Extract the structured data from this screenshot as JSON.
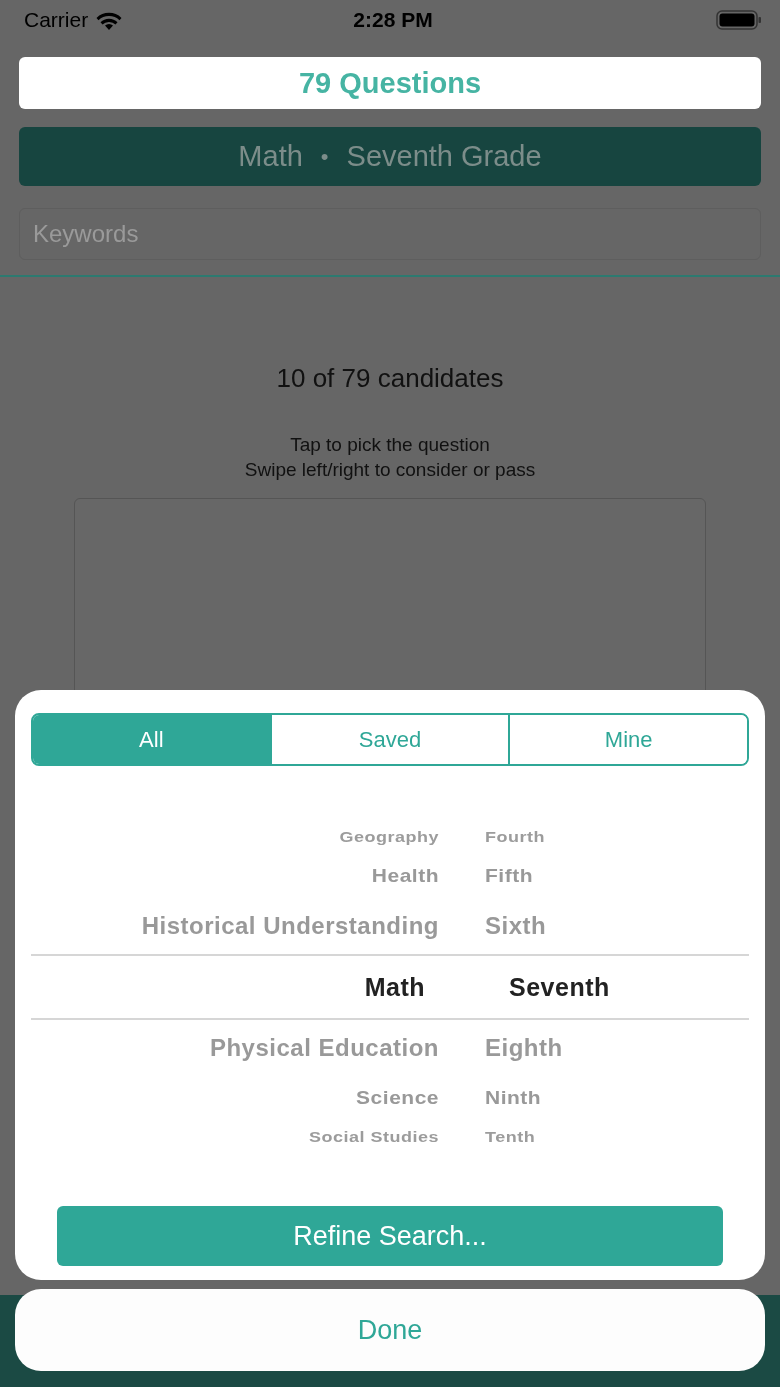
{
  "status_bar": {
    "carrier": "Carrier",
    "time": "2:28 PM"
  },
  "header": {
    "count_title": "79 Questions",
    "filter": {
      "subject": "Math",
      "separator": "•",
      "grade": "Seventh Grade"
    },
    "search": {
      "placeholder": "Keywords"
    }
  },
  "candidates": {
    "summary": "10 of 79 candidates",
    "instructions": [
      "Tap to pick the question",
      "Swipe left/right to consider or pass"
    ]
  },
  "sheet": {
    "segments": [
      {
        "label": "All",
        "selected": true
      },
      {
        "label": "Saved",
        "selected": false
      },
      {
        "label": "Mine",
        "selected": false
      }
    ],
    "picker": {
      "columns": [
        {
          "items": [
            {
              "label": "Geography",
              "selected": false
            },
            {
              "label": "Health",
              "selected": false
            },
            {
              "label": "Historical Understanding",
              "selected": false
            },
            {
              "label": "Math",
              "selected": true
            },
            {
              "label": "Physical Education",
              "selected": false
            },
            {
              "label": "Science",
              "selected": false
            },
            {
              "label": "Social Studies",
              "selected": false
            }
          ]
        },
        {
          "items": [
            {
              "label": "Fourth",
              "selected": false
            },
            {
              "label": "Fifth",
              "selected": false
            },
            {
              "label": "Sixth",
              "selected": false
            },
            {
              "label": "Seventh",
              "selected": true
            },
            {
              "label": "Eighth",
              "selected": false
            },
            {
              "label": "Ninth",
              "selected": false
            },
            {
              "label": "Tenth",
              "selected": false
            }
          ]
        }
      ]
    },
    "action": "Refine Search..."
  },
  "done": "Done"
}
